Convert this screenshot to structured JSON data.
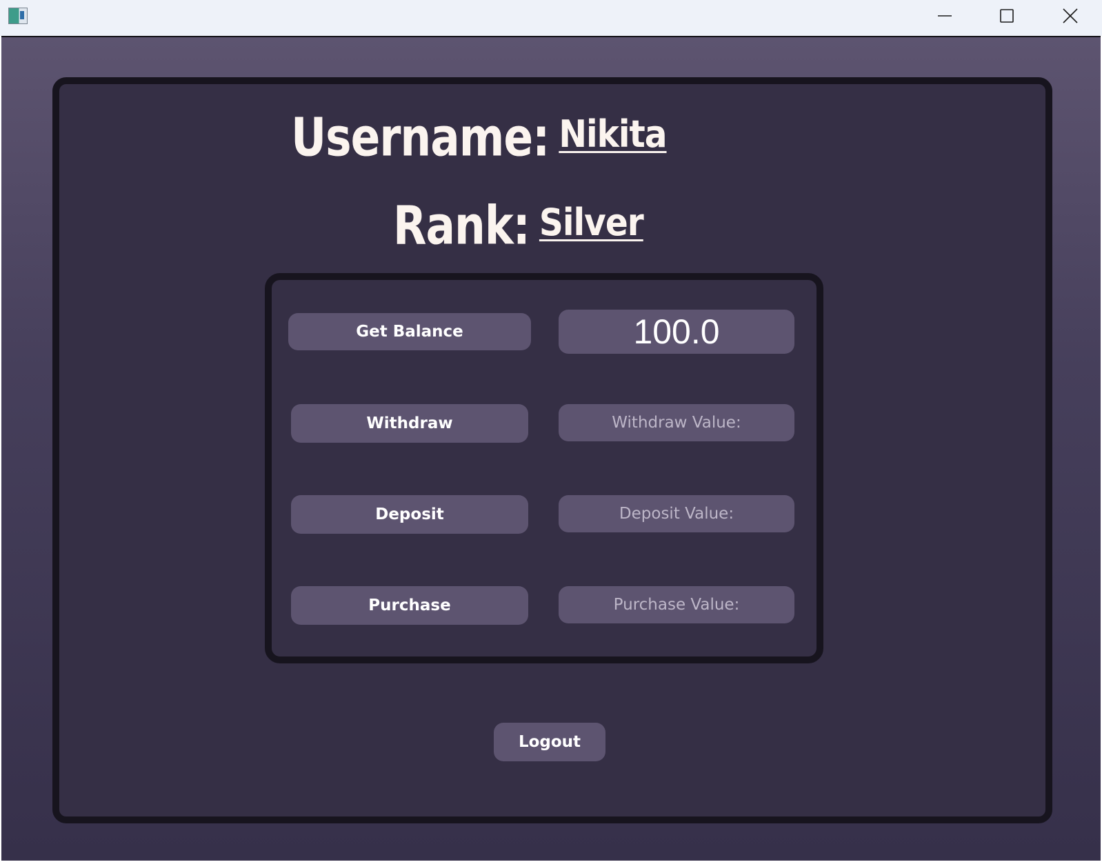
{
  "window": {
    "controls": {
      "minimize_icon": "minimize-icon",
      "maximize_icon": "maximize-icon",
      "close_icon": "close-icon"
    }
  },
  "profile": {
    "username_label": "Username:",
    "username_value": "Nikita",
    "rank_label": "Rank:",
    "rank_value": "Silver"
  },
  "actions": {
    "get_balance_label": "Get Balance",
    "balance_value": "100.0",
    "withdraw_label": "Withdraw",
    "withdraw_placeholder": "Withdraw Value:",
    "deposit_label": "Deposit",
    "deposit_placeholder": "Deposit Value:",
    "purchase_label": "Purchase",
    "purchase_placeholder": "Purchase Value:"
  },
  "logout_label": "Logout",
  "colors": {
    "background": "#5d5470",
    "panel": "#352f45",
    "border": "#17141e",
    "button": "#5d5470",
    "text": "#fbf4ef",
    "placeholder": "#bdb6c8"
  }
}
